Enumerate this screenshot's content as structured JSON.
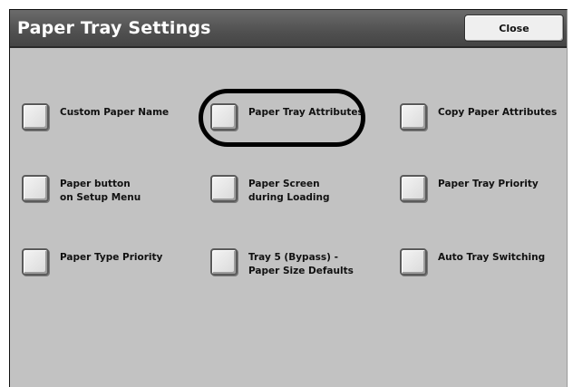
{
  "window": {
    "title": "Paper Tray Settings",
    "close_label": "Close"
  },
  "options": [
    {
      "line1": "Custom Paper Name",
      "line2": ""
    },
    {
      "line1": "Paper Tray Attributes",
      "line2": ""
    },
    {
      "line1": "Copy Paper Attributes",
      "line2": ""
    },
    {
      "line1": "Paper button",
      "line2": "on Setup Menu"
    },
    {
      "line1": "Paper Screen",
      "line2": "during Loading"
    },
    {
      "line1": "Paper Tray Priority",
      "line2": ""
    },
    {
      "line1": "Paper Type Priority",
      "line2": ""
    },
    {
      "line1": "Tray 5 (Bypass) -",
      "line2": "Paper Size Defaults"
    },
    {
      "line1": "Auto Tray Switching",
      "line2": ""
    }
  ],
  "colors": {
    "titlebar": "#505050",
    "panel": "#c2c2c2",
    "highlight_ring": "#000000"
  }
}
